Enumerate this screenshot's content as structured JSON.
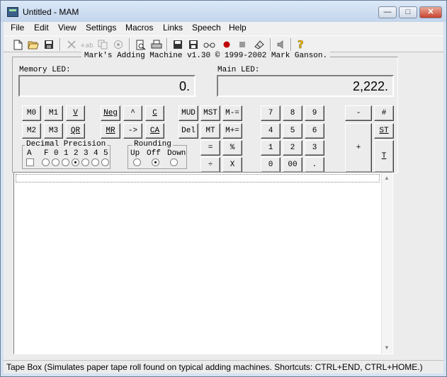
{
  "window": {
    "title": "Untitled - MAM",
    "minimize_label": "—",
    "maximize_label": "□",
    "close_label": "✕"
  },
  "menu": [
    "File",
    "Edit",
    "View",
    "Settings",
    "Macros",
    "Links",
    "Speech",
    "Help"
  ],
  "toolbar": {
    "icons": [
      "new-file-icon",
      "open-folder-icon",
      "save-icon",
      "cut-icon",
      "ab-replace-icon",
      "copy-icon",
      "paste-icon",
      "print-preview-icon",
      "print-icon",
      "save-tape-icon",
      "save-as-icon",
      "glasses-icon",
      "record-icon",
      "stop-icon",
      "eraser-icon",
      "speaker-icon",
      "help-icon"
    ]
  },
  "banner": "Mark's Adding Machine v1.30 © 1999-2002 Mark Ganson.",
  "memory_led": {
    "label": "Memory LED:",
    "value": "0."
  },
  "main_led": {
    "label": "Main LED:",
    "value": "2,222."
  },
  "buttons": {
    "m0": "M0",
    "m1": "M1",
    "v": "V",
    "neg": "Neg",
    "caret": "^",
    "c": "C",
    "m2": "M2",
    "m3": "M3",
    "qr": "QR",
    "mr": "MR",
    "arrow": "->",
    "ca": "CA",
    "mud": "MUD",
    "mst": "MST",
    "mminus": "M-=",
    "del": "Del",
    "mt": "MT",
    "mplus": "M+=",
    "eq": "=",
    "pct": "%",
    "div": "÷",
    "mul": "X",
    "n7": "7",
    "n8": "8",
    "n9": "9",
    "n4": "4",
    "n5": "5",
    "n6": "6",
    "n1": "1",
    "n2": "2",
    "n3": "3",
    "n0": "0",
    "n00": "00",
    "dot": ".",
    "minus": "-",
    "hash": "#",
    "plus": "+",
    "st": "ST",
    "t": "T"
  },
  "decimal_precision": {
    "title": "Decimal Precision",
    "options": [
      "A",
      "F",
      "0",
      "1",
      "2",
      "3",
      "4",
      "5"
    ],
    "selected": "2"
  },
  "rounding": {
    "title": "Rounding",
    "options": [
      "Up",
      "Off",
      "Down"
    ],
    "selected": "Off"
  },
  "statusbar": "Tape Box (Simulates paper tape roll found on typical adding machines.  Shortcuts: CTRL+END, CTRL+HOME.)"
}
